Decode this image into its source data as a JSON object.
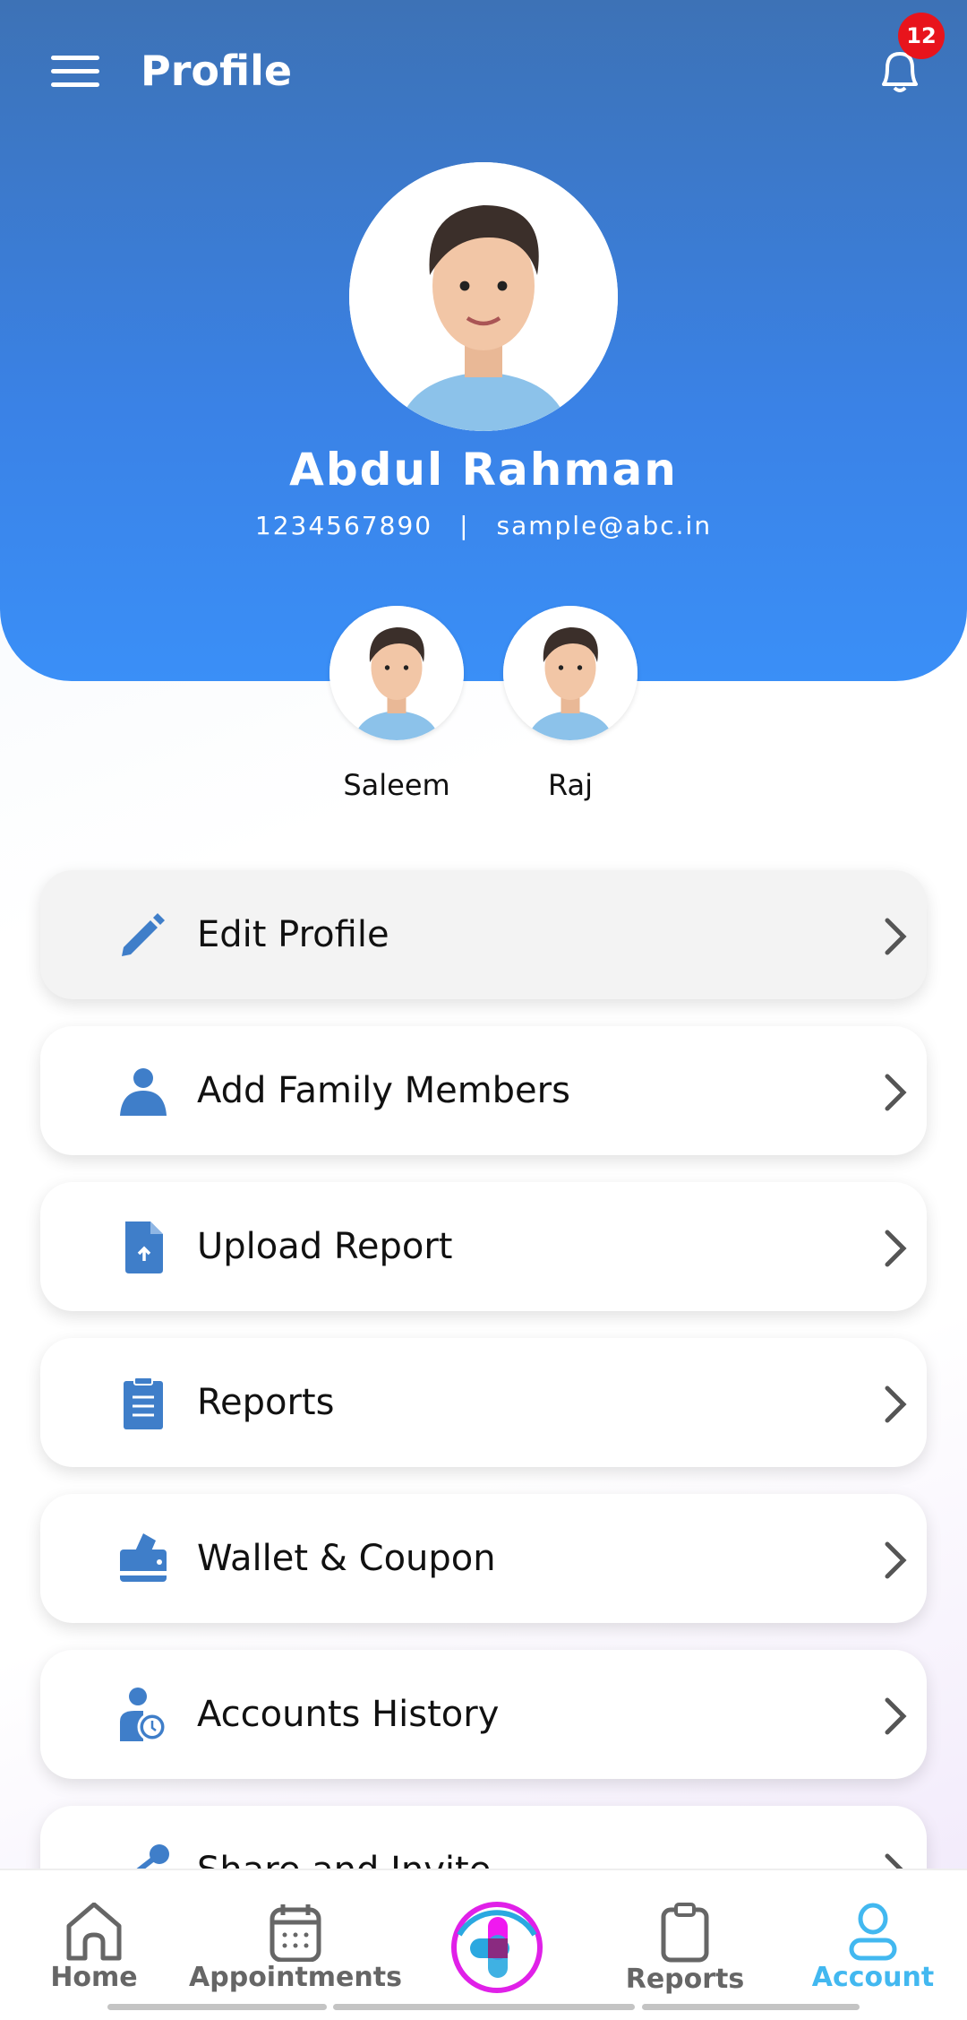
{
  "header": {
    "title": "Profile",
    "notification_count": "12"
  },
  "profile": {
    "name": "Abdul Rahman",
    "phone": "1234567890",
    "separator": "|",
    "email": "sample@abc.in"
  },
  "family": [
    {
      "name": "Saleem"
    },
    {
      "name": "Raj"
    }
  ],
  "menu": [
    {
      "label": "Edit Profile",
      "icon": "pencil-icon"
    },
    {
      "label": "Add Family Members",
      "icon": "person-icon"
    },
    {
      "label": "Upload Report",
      "icon": "file-upload-icon"
    },
    {
      "label": "Reports",
      "icon": "clipboard-icon"
    },
    {
      "label": "Wallet & Coupon",
      "icon": "wallet-icon"
    },
    {
      "label": "Accounts History",
      "icon": "user-clock-icon"
    },
    {
      "label": "Share and Invite",
      "icon": "share-icon"
    }
  ],
  "nav": {
    "home": "Home",
    "appointments": "Appointments",
    "reports": "Reports",
    "account": "Account",
    "active": "Account"
  },
  "colors": {
    "accent": "#3a82e6",
    "icon": "#3f7ec9",
    "active_nav": "#42b8f0",
    "badge": "#e8141c"
  }
}
